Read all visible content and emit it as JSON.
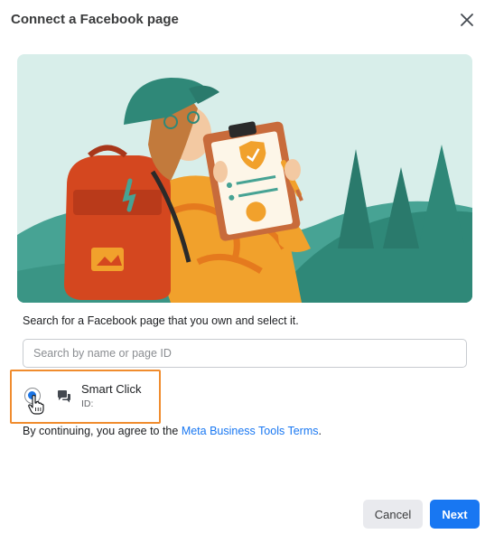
{
  "dialog": {
    "title": "Connect a Facebook page",
    "close_icon": "close-icon"
  },
  "illustration": {
    "description_icon": "illustration-person-with-clipboard"
  },
  "instruction": "Search for a Facebook page that you own and select it.",
  "search": {
    "placeholder": "Search by name or page ID",
    "value": ""
  },
  "result": {
    "name": "Smart Click",
    "id_label": "ID:",
    "selected": true,
    "icon": "messenger-icon"
  },
  "terms": {
    "prefix": "By continuing, you agree to the ",
    "link": "Meta Business Tools Terms",
    "suffix": "."
  },
  "buttons": {
    "cancel": "Cancel",
    "next": "Next"
  },
  "colors": {
    "primary": "#1877f2",
    "highlight_border": "#f08c2e",
    "hero_background": "#d8eeea"
  }
}
